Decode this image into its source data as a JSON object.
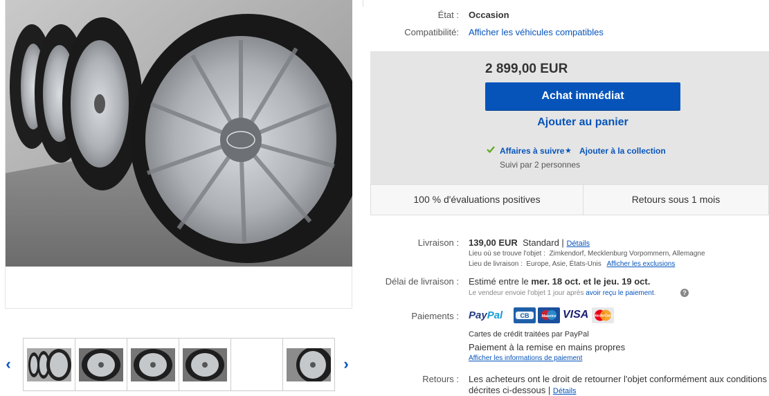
{
  "gallery": {
    "prev_arrow": "‹",
    "next_arrow": "›",
    "thumbnails": [
      {
        "kind": "wheels-row"
      },
      {
        "kind": "wheel-close"
      },
      {
        "kind": "wheel-close"
      },
      {
        "kind": "wheel-close"
      },
      {
        "kind": "empty"
      },
      {
        "kind": "wheel-side"
      }
    ]
  },
  "item_specifics": {
    "condition_label": "État :",
    "condition_value": "Occasion",
    "compat_label": "Compatibilité:",
    "compat_link": "Afficher les véhicules compatibles"
  },
  "buybox": {
    "price": "2 899,00 EUR",
    "buy_now": "Achat immédiat",
    "add_to_cart": "Ajouter au panier",
    "watch": "Affaires à suivre",
    "add_collection": "Ajouter à la collection",
    "followers": "Suivi par 2 personnes"
  },
  "badges": {
    "feedback": "100 % d'évaluations positives",
    "returns": "Retours sous 1 mois"
  },
  "shipping": {
    "label": "Livraison :",
    "cost": "139,00 EUR",
    "service": "Standard |",
    "details": "Détails",
    "location_label": "Lieu où se trouve l'objet :",
    "location": "Zimkendorf, Mecklenburg Vorpommern, Allemagne",
    "ship_to_label": "Lieu de livraison :",
    "ship_to": "Europe, Asie, États-Unis",
    "exclusions": "Afficher les exclusions"
  },
  "delivery": {
    "label": "Délai de livraison :",
    "estimate_prefix": "Estimé entre le",
    "date_from": "mer. 18 oct.",
    "and": "et le",
    "date_to": "jeu. 19 oct.",
    "note": "Le vendeur envoie l'objet 1 jour après",
    "note_link": "avoir reçu le paiement",
    "note_end": ".",
    "help": "?"
  },
  "payments": {
    "label": "Paiements :",
    "paypal_1": "Pay",
    "paypal_2": "Pal",
    "visa": "VISA",
    "card_cb": "CB",
    "card_maestro": "Maestro",
    "card_mastercard": "MasterCard",
    "credit_note": "Cartes de crédit traitées par PayPal",
    "in_person": "Paiement à la remise en mains propres",
    "info_link": "Afficher les informations de paiement"
  },
  "returns": {
    "label": "Retours :",
    "text_1": "Les acheteurs ont le droit de retourner l'objet conformément aux conditions",
    "text_2": "décrites ci-dessous |",
    "details": "Détails"
  },
  "colors": {
    "accent": "#0654ba",
    "buybox_bg": "#e5e5e5",
    "check_green": "#5ba71b"
  }
}
